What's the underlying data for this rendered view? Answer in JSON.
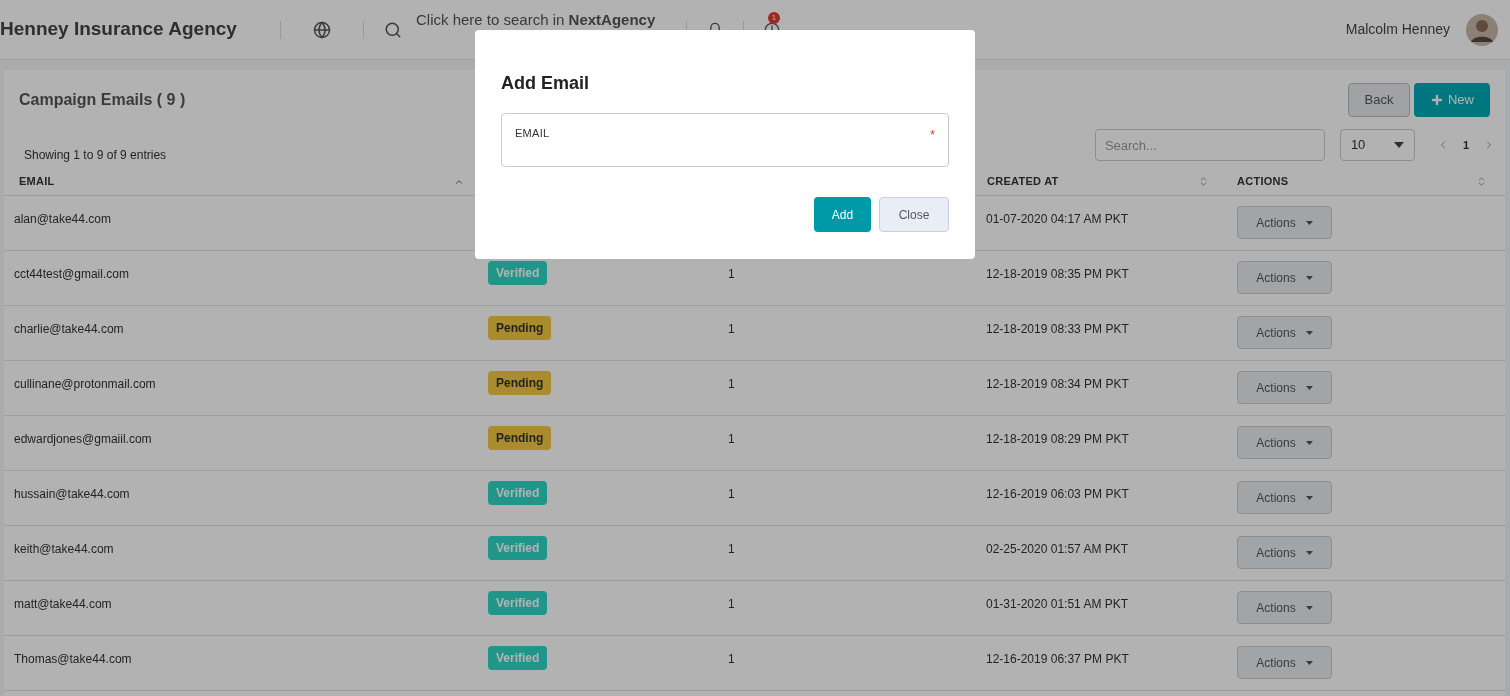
{
  "header": {
    "title": "Henney Insurance Agency",
    "search_placeholder": "Click here to search in **NextAgency**",
    "notification_count": "1",
    "user_name": "Malcolm Henney"
  },
  "page": {
    "title": "Campaign Emails ( 9 )",
    "back_button": "Back",
    "new_button": "New",
    "entries_info": "Showing 1 to 9 of 9 entries",
    "search": {
      "placeholder": "Search..."
    },
    "page_size": "10",
    "pages": [
      {
        "label": "1",
        "selected": true
      }
    ]
  },
  "table": {
    "columns": {
      "email": "EMAIL",
      "created_at": "CREATED AT",
      "actions": "ACTIONS"
    },
    "rows": [
      {
        "email": "alan@take44.com",
        "created_at": "01-07-2020 04:17 AM PKT",
        "actions": "Actions"
      },
      {
        "email": "cct44test@gmail.com",
        "status": {
          "label": "Verified",
          "kind": "verified"
        },
        "count": "1",
        "created_at": "12-18-2019 08:35 PM PKT",
        "actions": "Actions"
      },
      {
        "email": "charlie@take44.com",
        "status": {
          "label": "Pending",
          "kind": "pending"
        },
        "count": "1",
        "created_at": "12-18-2019 08:33 PM PKT",
        "actions": "Actions"
      },
      {
        "email": "cullinane@protonmail.com",
        "status": {
          "label": "Pending",
          "kind": "pending"
        },
        "count": "1",
        "created_at": "12-18-2019 08:34 PM PKT",
        "actions": "Actions"
      },
      {
        "email": "edwardjones@gmaiil.com",
        "status": {
          "label": "Pending",
          "kind": "pending"
        },
        "count": "1",
        "created_at": "12-18-2019 08:29 PM PKT",
        "actions": "Actions"
      },
      {
        "email": "hussain@take44.com",
        "status": {
          "label": "Verified",
          "kind": "verified"
        },
        "count": "1",
        "created_at": "12-16-2019 06:03 PM PKT",
        "actions": "Actions"
      },
      {
        "email": "keith@take44.com",
        "status": {
          "label": "Verified",
          "kind": "verified"
        },
        "count": "1",
        "created_at": "02-25-2020 01:57 AM PKT",
        "actions": "Actions"
      },
      {
        "email": "matt@take44.com",
        "status": {
          "label": "Verified",
          "kind": "verified"
        },
        "count": "1",
        "created_at": "01-31-2020 01:51 AM PKT",
        "actions": "Actions"
      },
      {
        "email": "Thomas@take44.com",
        "status": {
          "label": "Verified",
          "kind": "verified"
        },
        "count": "1",
        "created_at": "12-16-2019 06:37 PM PKT",
        "actions": "Actions"
      }
    ]
  },
  "modal": {
    "title": "Add Email",
    "field_label": "EMAIL",
    "required": true,
    "required_mark": "*",
    "add_button": "Add",
    "close_button": "Close"
  }
}
